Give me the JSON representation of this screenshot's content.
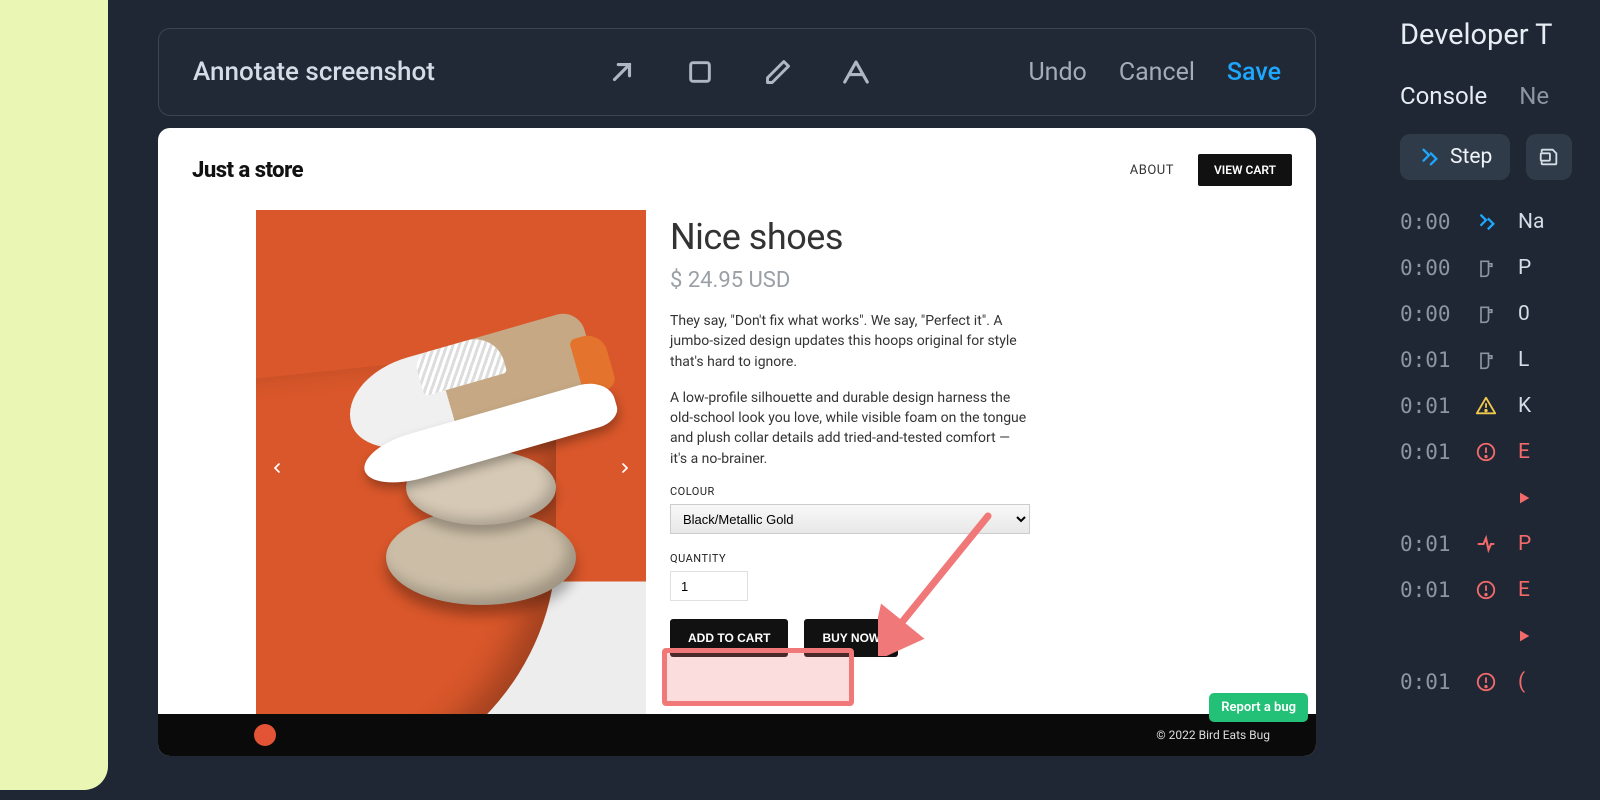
{
  "toolbar": {
    "title": "Annotate screenshot",
    "undo": "Undo",
    "cancel": "Cancel",
    "save": "Save"
  },
  "store": {
    "logo": "Just a store",
    "nav_about": "ABOUT",
    "view_cart": "VIEW CART",
    "product": {
      "title": "Nice shoes",
      "price": "$ 24.95 USD",
      "desc1": "They say, \"Don't fix what works\". We say, \"Perfect it\". A jumbo-sized design updates this hoops original for style that's hard to ignore.",
      "desc2": "A low-profile silhouette and durable design harness the old-school look you love, while visible foam on the tongue and plush collar details add tried-and-tested comfort — it's a no-brainer.",
      "label_colour": "COLOUR",
      "colour_value": "Black/Metallic Gold",
      "label_quantity": "QUANTITY",
      "quantity_value": "1",
      "add_to_cart": "ADD TO CART",
      "buy_now": "BUY NOW"
    },
    "report_bug": "Report a bug",
    "copyright": "© 2022 Bird Eats Bug"
  },
  "devtools": {
    "title": "Developer T",
    "tabs": {
      "console": "Console",
      "network": "Ne"
    },
    "chip_step": "Step",
    "logs": [
      {
        "time": "0:00",
        "icon": "step",
        "text": "Na"
      },
      {
        "time": "0:00",
        "icon": "storage",
        "text": "P"
      },
      {
        "time": "0:00",
        "icon": "storage",
        "text": "0"
      },
      {
        "time": "0:01",
        "icon": "storage",
        "text": "L"
      },
      {
        "time": "0:01",
        "icon": "warn",
        "text": "K"
      },
      {
        "time": "0:01",
        "icon": "error",
        "text": "E"
      },
      {
        "time": "",
        "icon": "play-red",
        "text": ""
      },
      {
        "time": "0:01",
        "icon": "net-red",
        "text": "P"
      },
      {
        "time": "0:01",
        "icon": "error",
        "text": "E"
      },
      {
        "time": "",
        "icon": "play-red",
        "text": ""
      },
      {
        "time": "0:01",
        "icon": "error",
        "text": "("
      }
    ]
  }
}
